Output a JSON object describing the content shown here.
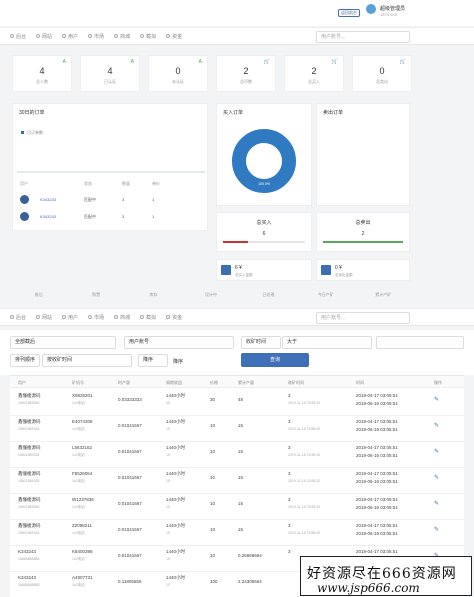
{
  "topbar": {
    "badge": "返回前台",
    "brand_name": "超级管理员",
    "brand_sub": "137XXXX"
  },
  "nav": {
    "items": [
      "后台",
      "网站",
      "用户",
      "市场",
      "商城",
      "截拟",
      "资金"
    ],
    "search_placeholder": "用户账号..."
  },
  "stats": [
    {
      "value": "4",
      "label": "总人数",
      "icon": "A"
    },
    {
      "value": "4",
      "label": "已认证",
      "icon": "A"
    },
    {
      "value": "0",
      "label": "未认证",
      "icon": "A"
    },
    {
      "value": "2",
      "label": "总币数",
      "icon": "cart"
    },
    {
      "value": "2",
      "label": "总买入",
      "icon": "cart"
    },
    {
      "value": "0",
      "label": "总卖出",
      "icon": "cart"
    }
  ],
  "panels": {
    "orders30": {
      "title": "30日的订单",
      "legend": "日订单数",
      "headers": [
        "用户",
        "状态",
        "数量",
        "单价"
      ],
      "rows": [
        {
          "user": "K343243",
          "status": "匹配中",
          "qty": "3",
          "price": "1"
        },
        {
          "user": "K343243",
          "status": "匹配中",
          "qty": "3",
          "price": "1"
        }
      ]
    },
    "buy": {
      "title": "买入订单",
      "donut_label": "100.0%"
    },
    "sell": {
      "title": "卖出订单"
    },
    "total_buy": {
      "title": "总买入",
      "value": "6",
      "fill_pct": 30,
      "color": "#cc3333"
    },
    "total_sell": {
      "title": "总卖出",
      "value": "2",
      "fill_pct": 100,
      "color": "#58a55c"
    },
    "mini1": {
      "value": "6 ¥",
      "label": "总买入金额"
    },
    "mini2": {
      "value": "0 ¥",
      "label": "总卖出金额"
    }
  },
  "strip": [
    "账后",
    "购置",
    "库存",
    "设计中",
    "已处理",
    "今日产矿",
    "累计产矿"
  ],
  "filters": {
    "category": "全部截后",
    "account_label": "用户账号",
    "time_label": "收矿时间",
    "compare": "大于",
    "sort_label": "排列顺序",
    "sort_value": "按收矿时间",
    "order": "降序",
    "order2": "降序",
    "query": "查询"
  },
  "table": {
    "headers": [
      "用户",
      "矿机号",
      "时产量",
      "周期收益",
      "价格",
      "累计产量",
      "收矿时间",
      "时间",
      "操作"
    ],
    "rows": [
      {
        "user": "鑫懂梭源码",
        "phone": "15821889334",
        "code": "X9825201",
        "code_sub": "1x2电站",
        "rate": "0.03333333",
        "cycle": "1440小时",
        "cycle_sub": "48",
        "price": "30",
        "total": "48",
        "collect": "3",
        "collect_sub": "2019-11-15 23:59:32",
        "time1": "2019-04-17 03:05:51",
        "time2": "2019-06-16 03:05:51"
      },
      {
        "user": "鑫懂梭源码",
        "phone": "15821889334",
        "code": "E4074306",
        "code_sub": "1x2电站",
        "rate": "0.01041667",
        "cycle": "1440小时",
        "cycle_sub": "15",
        "price": "10",
        "total": "15",
        "collect": "3",
        "collect_sub": "2019-11-15 23:59:32",
        "time1": "2019-04-17 03:05:51",
        "time2": "2019-06-16 03:05:51"
      },
      {
        "user": "鑫懂梭源码",
        "phone": "15821889334",
        "code": "L5632162",
        "code_sub": "1x2电站",
        "rate": "0.01041667",
        "cycle": "1440小时",
        "cycle_sub": "15",
        "price": "10",
        "total": "15",
        "collect": "3",
        "collect_sub": "2019-11-15 23:59:32",
        "time1": "2019-04-17 03:05:51",
        "time2": "2019-06-16 03:05:51"
      },
      {
        "user": "鑫懂梭源码",
        "phone": "15821889334",
        "code": "F5526054",
        "code_sub": "1x2电站",
        "rate": "0.01041667",
        "cycle": "1440小时",
        "cycle_sub": "15",
        "price": "10",
        "total": "15",
        "collect": "3",
        "collect_sub": "2019-11-15 23:59:32",
        "time1": "2019-04-17 03:05:51",
        "time2": "2019-06-16 03:05:51"
      },
      {
        "user": "鑫懂梭源码",
        "phone": "15821889334",
        "code": "W1237836",
        "code_sub": "1x2电站",
        "rate": "0.01041667",
        "cycle": "1440小时",
        "cycle_sub": "15",
        "price": "10",
        "total": "15",
        "collect": "3",
        "collect_sub": "2019-11-15 23:59:32",
        "time1": "2019-04-17 03:05:51",
        "time2": "2019-06-16 03:05:51"
      },
      {
        "user": "鑫懂梭源码",
        "phone": "15821889334",
        "code": "Z2098211",
        "code_sub": "1x2电站",
        "rate": "0.01041667",
        "cycle": "1440小时",
        "cycle_sub": "15",
        "price": "10",
        "total": "15",
        "collect": "3",
        "collect_sub": "2019-11-15 23:59:32",
        "time1": "2019-04-17 03:05:51",
        "time2": "2019-06-16 03:05:51"
      },
      {
        "user": "K343243",
        "phone": "18888888888",
        "code": "K8400398",
        "code_sub": "1x2电站",
        "rate": "0.01041667",
        "cycle": "1440小时",
        "cycle_sub": "15",
        "price": "10",
        "total": "0.26666664",
        "collect": "3",
        "collect_sub": "",
        "time1": "2019-04-17 03:05:51",
        "time2": ""
      },
      {
        "user": "K343243",
        "phone": "18888888888",
        "code": "A4807731",
        "code_sub": "1x2电站",
        "rate": "0.11805556",
        "cycle": "1440小时",
        "cycle_sub": "10",
        "price": "100",
        "total": "2.24305564",
        "collect": "",
        "collect_sub": "",
        "time1": "",
        "time2": ""
      }
    ]
  },
  "watermark": {
    "line1": "好资源尽在666资源网",
    "line2": "www.jsp666.com"
  }
}
